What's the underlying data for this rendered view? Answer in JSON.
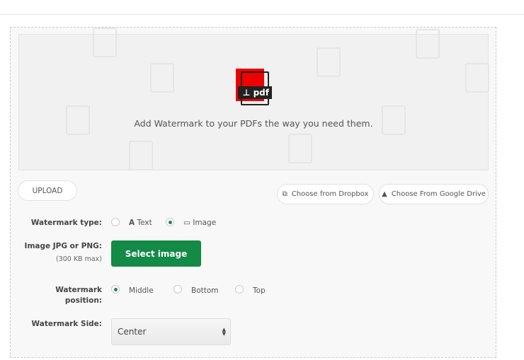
{
  "dropzone": {
    "tagline": "Add Watermark to your PDFs the way you need them.",
    "icon": "pdf-stamp-icon",
    "icon_label": "pdf"
  },
  "upload": {
    "upload_label": "UPLOAD",
    "dropbox_label": "Choose from Dropbox",
    "gdrive_label": "Choose From Google Drive"
  },
  "form": {
    "type_label": "Watermark type:",
    "type_options": [
      {
        "label": "Text",
        "icon": "font-icon",
        "selected": false
      },
      {
        "label": "Image",
        "icon": "image-icon",
        "selected": true
      }
    ],
    "image_label": "Image JPG or PNG:",
    "image_hint": "(300 KB max)",
    "select_image_label": "Select image",
    "position_label_1": "Watermark",
    "position_label_2": "position:",
    "position_options": [
      {
        "label": "Middle",
        "selected": true
      },
      {
        "label": "Bottom",
        "selected": false
      },
      {
        "label": "Top",
        "selected": false
      }
    ],
    "side_label": "Watermark Side:",
    "side_value": "Center"
  },
  "colors": {
    "accent": "#138a45",
    "pdf_red": "#ee0000"
  }
}
